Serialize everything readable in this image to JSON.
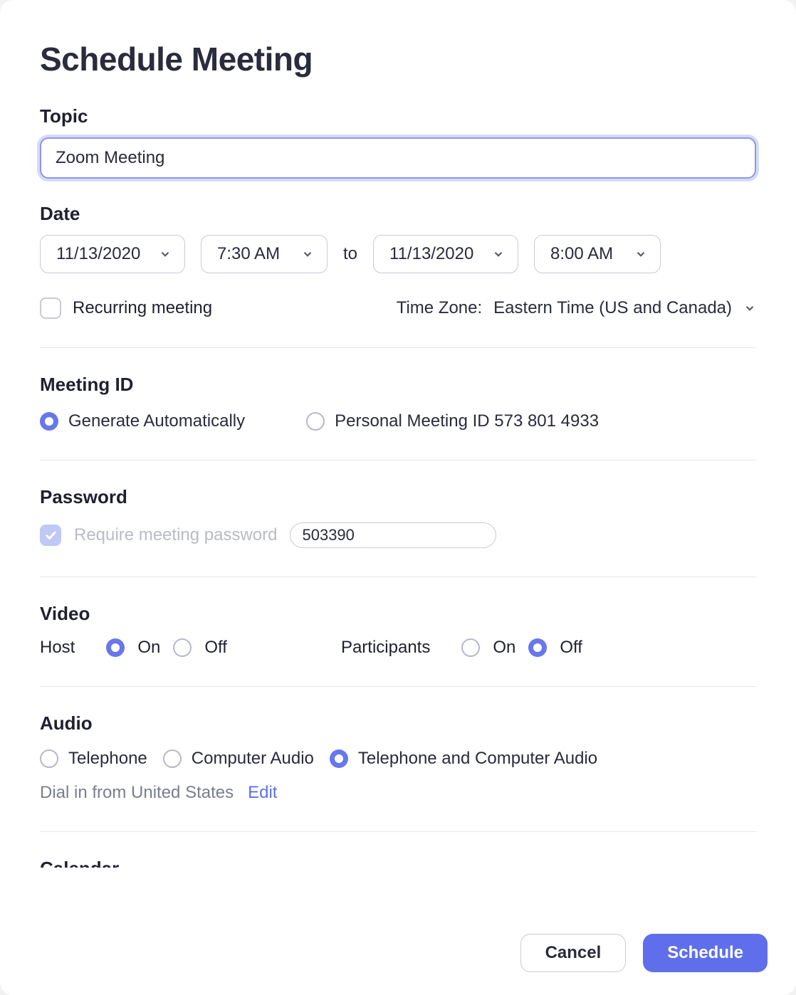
{
  "title": "Schedule Meeting",
  "topic": {
    "label": "Topic",
    "value": "Zoom Meeting"
  },
  "date": {
    "label": "Date",
    "start_date": "11/13/2020",
    "start_time": "7:30 AM",
    "to_label": "to",
    "end_date": "11/13/2020",
    "end_time": "8:00 AM",
    "recurring_label": "Recurring meeting",
    "recurring_checked": false,
    "timezone_label": "Time Zone:",
    "timezone_value": "Eastern Time (US and Canada)"
  },
  "meeting_id": {
    "label": "Meeting ID",
    "generate_label": "Generate Automatically",
    "personal_label": "Personal Meeting ID 573 801 4933",
    "selected": "generate"
  },
  "password": {
    "label": "Password",
    "require_label": "Require meeting password",
    "require_checked": true,
    "value": "503390"
  },
  "video": {
    "label": "Video",
    "host_label": "Host",
    "host_value": "on",
    "participants_label": "Participants",
    "participants_value": "off",
    "on_label": "On",
    "off_label": "Off"
  },
  "audio": {
    "label": "Audio",
    "telephone_label": "Telephone",
    "computer_label": "Computer Audio",
    "both_label": "Telephone and Computer Audio",
    "selected": "both",
    "dial_in_text": "Dial in from United States",
    "edit_label": "Edit"
  },
  "footer": {
    "cancel_label": "Cancel",
    "schedule_label": "Schedule"
  }
}
